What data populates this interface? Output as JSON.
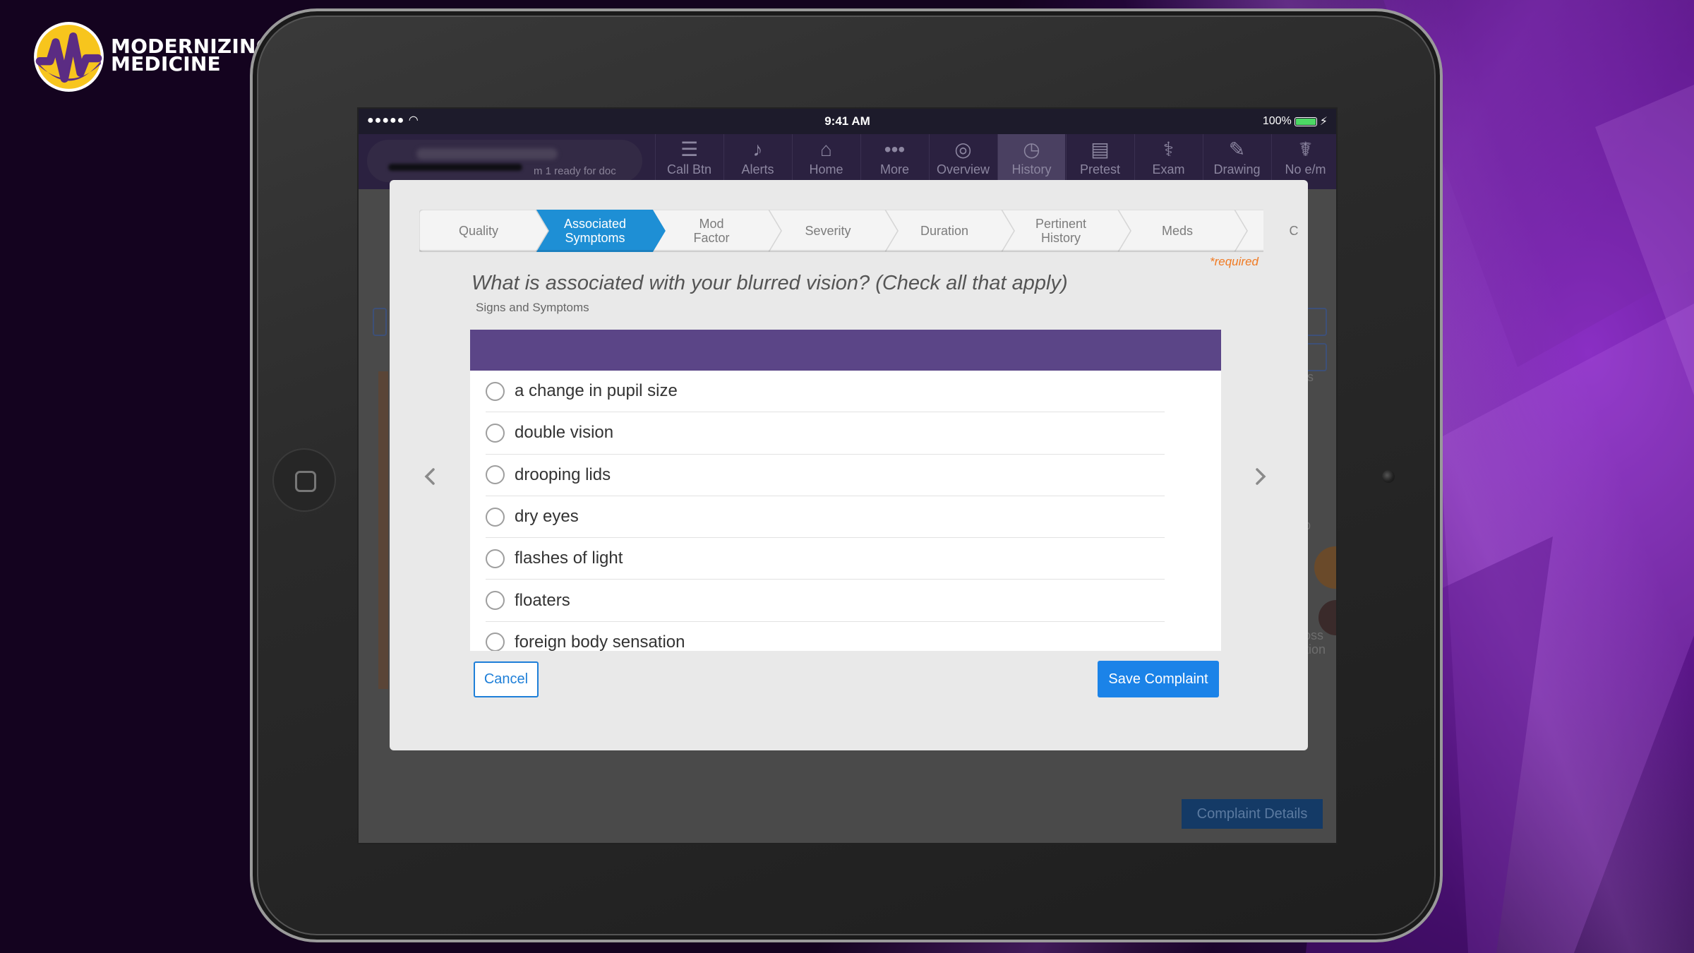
{
  "brand": {
    "line1": "MODERNIZING",
    "line2": "MEDICINE",
    "colors": {
      "yellow": "#f7c51d",
      "purple": "#5b2c83"
    }
  },
  "status_bar": {
    "signal": "●●●●● ",
    "time": "9:41 AM",
    "battery": "100%"
  },
  "nav": {
    "patient_status": "m 1 ready for doc",
    "items": [
      {
        "label": "Call Btn",
        "icon": "list-icon"
      },
      {
        "label": "Alerts",
        "icon": "bell-icon"
      },
      {
        "label": "Home",
        "icon": "home-icon"
      },
      {
        "label": "More",
        "icon": "more-icon"
      },
      {
        "label": "Overview",
        "icon": "person-icon"
      },
      {
        "label": "History",
        "icon": "clock-icon",
        "active": true
      },
      {
        "label": "Pretest",
        "icon": "monitor-icon"
      },
      {
        "label": "Exam",
        "icon": "stethoscope-icon"
      },
      {
        "label": "Drawing",
        "icon": "pencil-icon"
      },
      {
        "label": "No e/m",
        "icon": "caduceus-icon"
      }
    ]
  },
  "background": {
    "side_labels": [
      "es",
      "ial",
      "mp",
      "us",
      "Cross",
      "Section"
    ],
    "details_button": "Complaint Details"
  },
  "modal": {
    "steps": [
      {
        "label_1": "Quality",
        "label_2": ""
      },
      {
        "label_1": "Associated",
        "label_2": "Symptoms",
        "active": true
      },
      {
        "label_1": "Mod",
        "label_2": "Factor"
      },
      {
        "label_1": "Severity",
        "label_2": ""
      },
      {
        "label_1": "Duration",
        "label_2": ""
      },
      {
        "label_1": "Pertinent",
        "label_2": "History"
      },
      {
        "label_1": "Meds",
        "label_2": ""
      },
      {
        "label_1": "C",
        "label_2": ""
      }
    ],
    "required_note": "*required",
    "question": "What is associated with your blurred vision? (Check all that apply)",
    "subtitle": "Signs and Symptoms",
    "options": [
      "a change in pupil size",
      "double vision",
      "drooping lids",
      "dry eyes",
      "flashes of light",
      "floaters",
      "foreign body sensation"
    ],
    "cancel_label": "Cancel",
    "save_label": "Save Complaint",
    "colors": {
      "active_step": "#1e8fd5",
      "list_header": "#5b4587",
      "primary_button": "#1b83e8",
      "required": "#f07a22"
    }
  }
}
